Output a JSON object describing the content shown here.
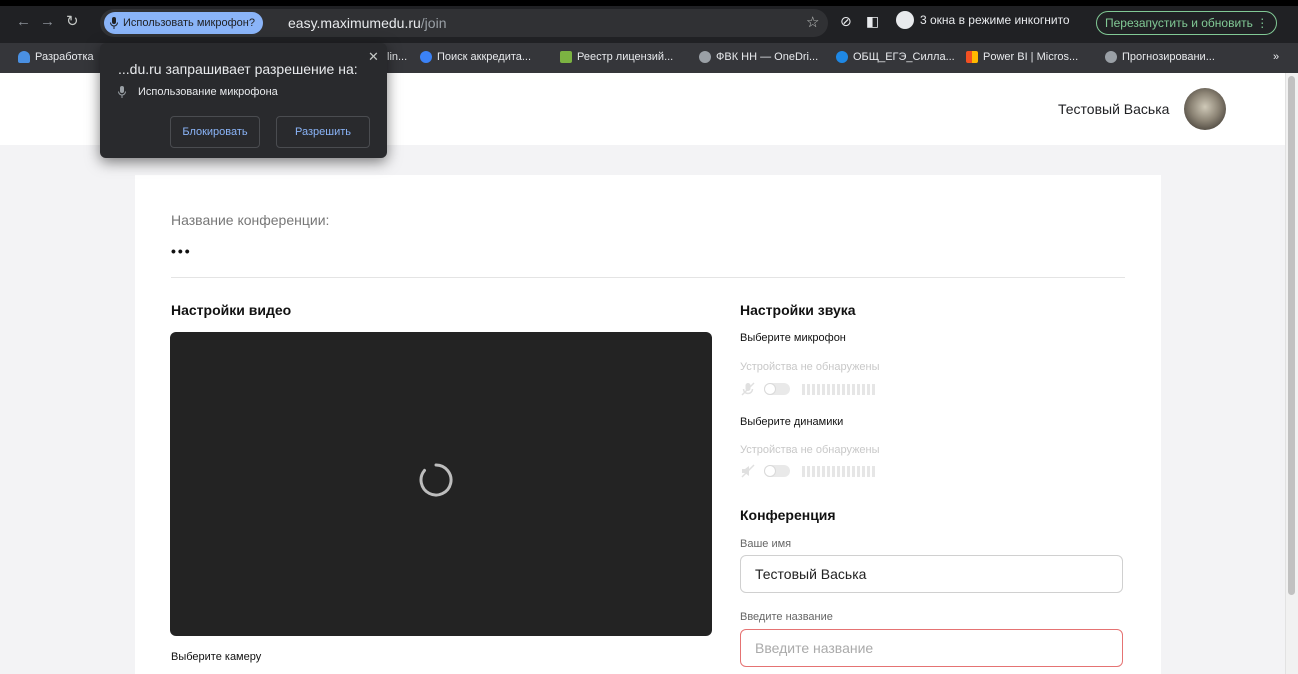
{
  "browser": {
    "mic_chip": "Использовать микрофон?",
    "url_host": "easy.maximumedu.ru",
    "url_path": "/join",
    "incognito_label": "3 окна в режиме инкогнито",
    "relaunch_label": "Перезапустить и обновить",
    "bookmarks": [
      "Разработка",
      "lin...",
      "Поиск аккредита...",
      "Реестр лицензий...",
      "ФВК НН — OneDri...",
      "ОБЩ_ЕГЭ_Силла...",
      "Power BI | Micros...",
      "Прогнозировани..."
    ],
    "bookmark_more": "»"
  },
  "permission_popup": {
    "title": "...du.ru запрашивает разрешение на:",
    "item": "Использование микрофона",
    "block_label": "Блокировать",
    "allow_label": "Разрешить"
  },
  "header": {
    "user_name": "Тестовый Васька"
  },
  "conference": {
    "name_label": "Название конференции:",
    "name_value": "•••"
  },
  "video": {
    "title": "Настройки видео",
    "camera_label": "Выберите камеру"
  },
  "audio": {
    "title": "Настройки звука",
    "mic_label": "Выберите микрофон",
    "mic_status": "Устройства не обнаружены",
    "speaker_label": "Выберите динамики",
    "speaker_status": "Устройства не обнаружены"
  },
  "conf_form": {
    "title": "Конференция",
    "name_label": "Ваше имя",
    "name_value": "Тестовый Васька",
    "title_label": "Введите название",
    "title_placeholder": "Введите название"
  },
  "colors": {
    "browser_bg": "#202124",
    "accent_blue": "#8ab4f8",
    "relaunch_green": "#81c995",
    "error_border": "#e57373"
  }
}
